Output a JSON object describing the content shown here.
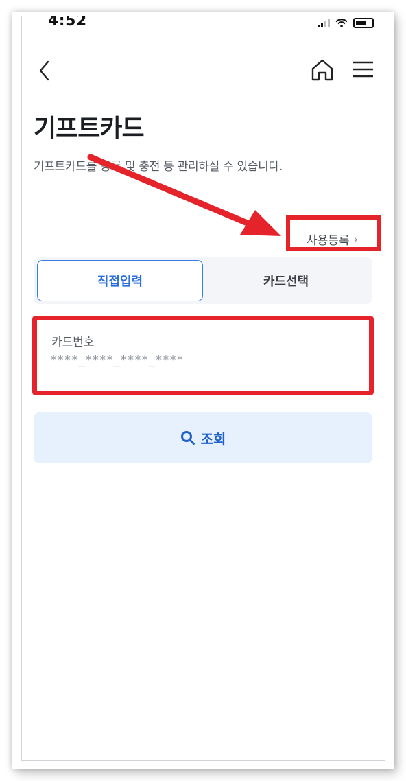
{
  "status_bar": {
    "time": "4:52"
  },
  "header": {
    "back_icon": "chevron-left-icon",
    "home_icon": "home-icon",
    "menu_icon": "hamburger-menu-icon"
  },
  "page": {
    "title": "기프트카드",
    "description": "기프트카드를 등록 및 충전 등 관리하실 수 있습니다.",
    "register_link": "사용등록",
    "register_chevron": "›"
  },
  "tabs": [
    {
      "label": "직접입력",
      "active": true
    },
    {
      "label": "카드선택",
      "active": false
    }
  ],
  "card_field": {
    "label": "카드번호",
    "placeholder": "****_****_****_****"
  },
  "search_button": {
    "label": "조회",
    "icon": "search-icon"
  },
  "colors": {
    "accent": "#2a6fdb",
    "highlight": "#e4232b",
    "button_bg": "#e7f1fd"
  }
}
